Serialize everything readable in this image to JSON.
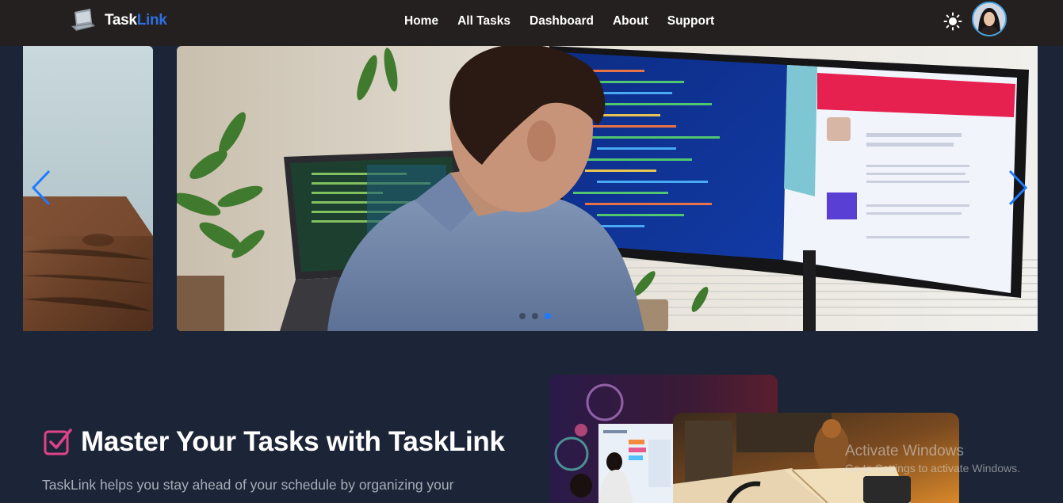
{
  "navbar": {
    "brand_part1": "Task",
    "brand_part2": "Link",
    "links": [
      {
        "label": "Home"
      },
      {
        "label": "All Tasks"
      },
      {
        "label": "Dashboard"
      },
      {
        "label": "About"
      },
      {
        "label": "Support"
      }
    ],
    "theme_icon": "sun-icon",
    "brand_color": "#2f6fe4"
  },
  "carousel": {
    "slide_count": 3,
    "active_index": 0,
    "accent": "#1e7bff"
  },
  "hero": {
    "title": "Master Your Tasks with TaskLink",
    "description": "TaskLink helps you stay ahead of your schedule by organizing your",
    "icon_color": "#e0428a"
  },
  "watermark": {
    "title": "Activate Windows",
    "subtitle": "Go to Settings to activate Windows."
  }
}
